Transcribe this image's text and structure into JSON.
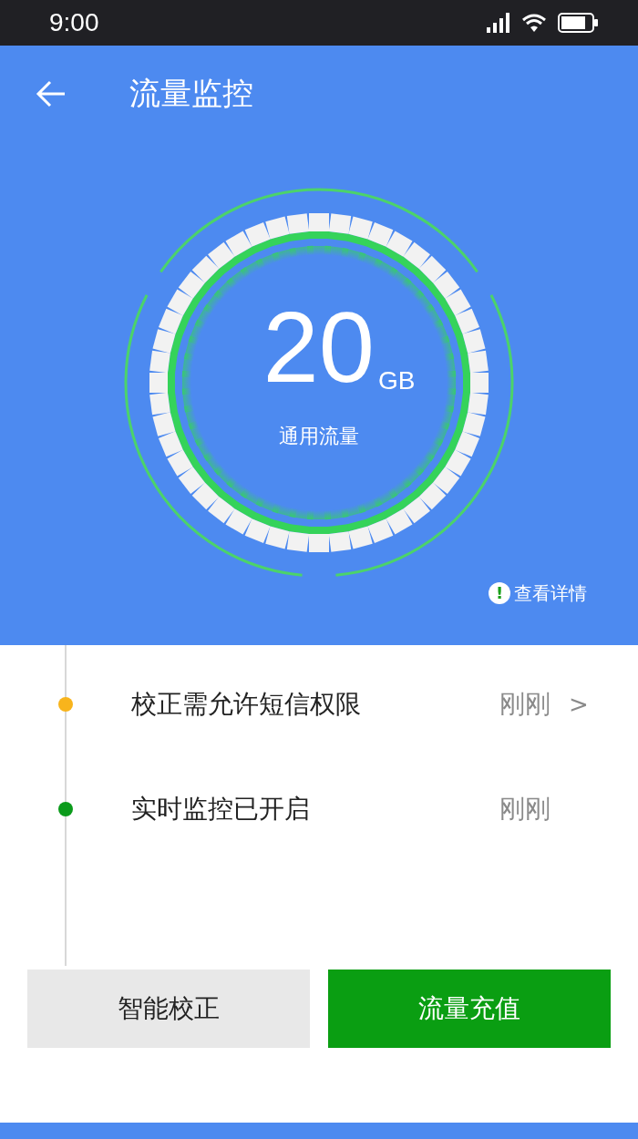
{
  "status_bar": {
    "time": "9:00"
  },
  "header": {
    "title": "流量监控"
  },
  "gauge": {
    "value": "20",
    "unit": "GB",
    "label": "通用流量"
  },
  "details_link": {
    "icon_text": "!",
    "label": "查看详情"
  },
  "events": [
    {
      "text": "校正需允许短信权限",
      "time": "刚刚",
      "chevron": ">",
      "color": "#f8b41c"
    },
    {
      "text": "实时监控已开启",
      "time": "刚刚",
      "color": "#0b9b1b"
    }
  ],
  "buttons": [
    {
      "label": "智能校正",
      "kind": "secondary"
    },
    {
      "label": "流量充值",
      "kind": "primary"
    }
  ]
}
